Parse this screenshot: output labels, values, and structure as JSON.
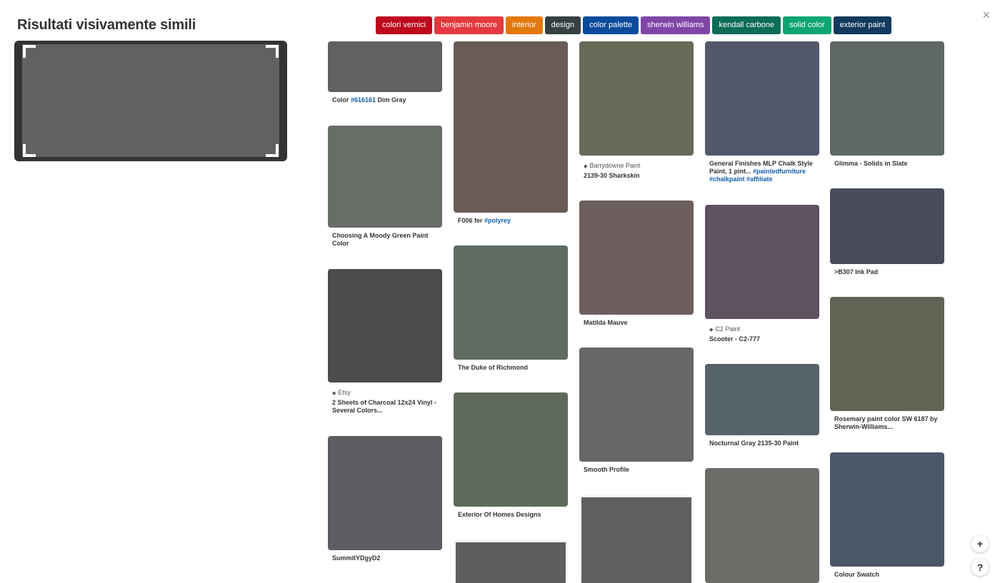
{
  "title": "Risultati visivamente simili",
  "preview": {
    "color": "#616161"
  },
  "tags": [
    {
      "label": "colori vernici",
      "color": "#bd081c"
    },
    {
      "label": "benjamin moore",
      "color": "#e3393f"
    },
    {
      "label": "interior",
      "color": "#e3780c"
    },
    {
      "label": "design",
      "color": "#364044"
    },
    {
      "label": "color palette",
      "color": "#0b4b9c"
    },
    {
      "label": "sherwin williams",
      "color": "#8046a7"
    },
    {
      "label": "kendall carbone",
      "color": "#0a6b56"
    },
    {
      "label": "solid color",
      "color": "#0fa573"
    },
    {
      "label": "exterior paint",
      "color": "#133a5e"
    }
  ],
  "pins": [
    {
      "color": "#616161",
      "caption": "Color ",
      "hashtag": "#616161",
      "caption_after": " Dim Gray"
    },
    {
      "color": "#696d67",
      "caption": "Choosing A Moody Green Paint Color"
    },
    {
      "color": "#4a4d4b",
      "source": "Etsy",
      "caption": "2 Sheets of Charcoal 12x24 Vinyl - Several Colors..."
    },
    {
      "color": "#5c5d61",
      "caption": "SummitYDgyD2"
    },
    {
      "color": "#695c57",
      "caption": "F006 fer ",
      "hashtag": "#polyrey"
    },
    {
      "color": "#616b63",
      "caption": "The Duke of Richmond"
    },
    {
      "color": "#5f6a5c",
      "caption": "Exterior Of Homes Designs"
    },
    {
      "color": "#5e5e5e",
      "caption": ""
    },
    {
      "color": "#6a6a5b",
      "source": "Barrydowne Paint",
      "caption": "2139-30 Sharkskin"
    },
    {
      "color": "#6c5f5d",
      "caption": "Matilda Mauve"
    },
    {
      "color": "#676767",
      "caption": "Smooth Profile"
    },
    {
      "color": "#5f5f5f",
      "caption": ""
    },
    {
      "color": "#53586b",
      "caption": "General Finishes MLP Chalk Style Paint, 1 pint... ",
      "hashtag": "#paintedfurniture #chalkpaint #affiliate"
    },
    {
      "color": "#5e5162",
      "source": "C2 Paint",
      "caption": "Scooter - C2-777"
    },
    {
      "color": "#56636a",
      "caption": "Nocturnal Gray 2135-30 Paint"
    },
    {
      "color": "#6d6c68",
      "caption": ""
    },
    {
      "color": "#5f6863",
      "caption": "Glimma - Solids in Slate"
    },
    {
      "color": "#474b5c",
      "caption": ">B307 Ink Pad"
    },
    {
      "color": "#5f6455",
      "caption": "Rosemary paint color SW 6187 by Sherwin-Williams..."
    },
    {
      "color": "#4a5768",
      "caption": "Colour Swatch"
    }
  ],
  "controls": {
    "close": "×",
    "add": "+",
    "help": "?"
  }
}
